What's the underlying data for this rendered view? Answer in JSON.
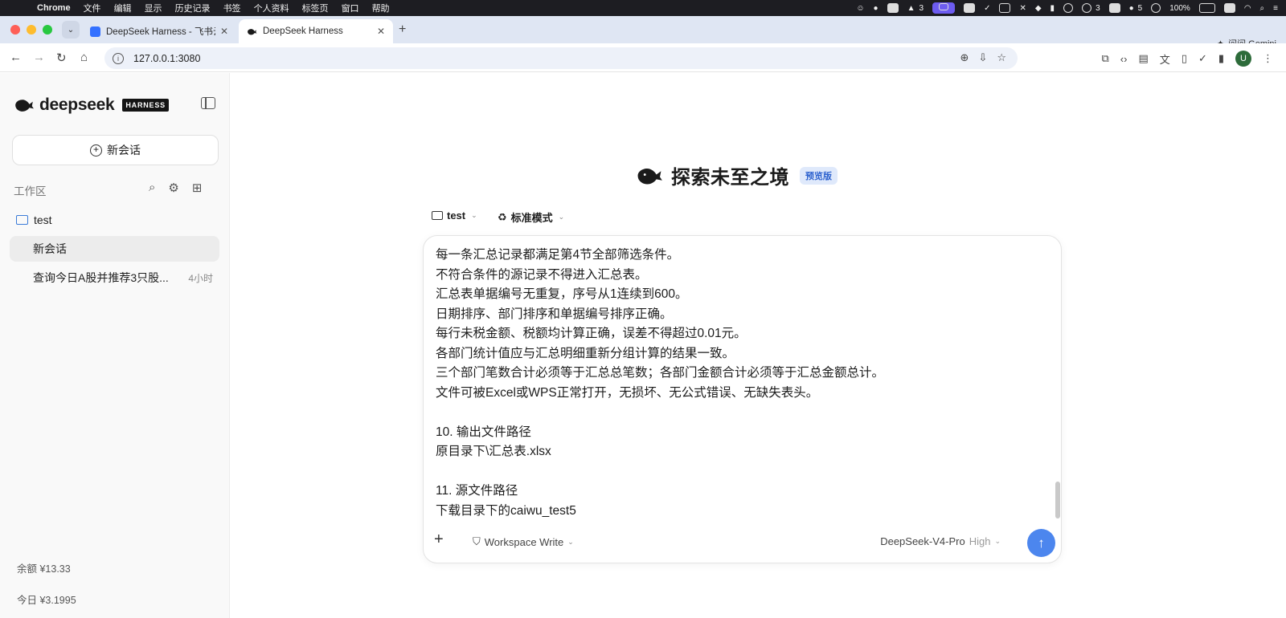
{
  "menubar": {
    "app": "Chrome",
    "items": [
      "文件",
      "编辑",
      "显示",
      "历史记录",
      "书签",
      "个人资料",
      "标签页",
      "窗口",
      "帮助"
    ],
    "status_count_a": "3",
    "status_count_b": "3",
    "status_count_c": "5",
    "battery": "100%"
  },
  "browser": {
    "tabs": [
      {
        "title": "DeepSeek Harness - 飞书云文档",
        "active": false
      },
      {
        "title": "DeepSeek Harness",
        "active": true
      }
    ],
    "url": "127.0.0.1:3080",
    "gemini_label": "问问 Gemini",
    "avatar_letter": "U"
  },
  "sidebar": {
    "brand": "deepseek",
    "badge": "HARNESS",
    "new_chat_label": "新会话",
    "workspace_label": "工作区",
    "folder_name": "test",
    "chats": [
      {
        "title": "新会话",
        "time": "",
        "selected": true
      },
      {
        "title": "查询今日A股并推荐3只股...",
        "time": "4小时",
        "selected": false
      }
    ],
    "balance": "余额 ¥13.33",
    "today": "今日 ¥3.1995"
  },
  "main": {
    "title": "探索未至之境",
    "badge": "预览版",
    "folder_selector": "test",
    "mode_selector": "标准模式",
    "composer_lines": [
      "每一条汇总记录都满足第4节全部筛选条件。",
      "不符合条件的源记录不得进入汇总表。",
      "汇总表单据编号无重复，序号从1连续到600。",
      "日期排序、部门排序和单据编号排序正确。",
      "每行未税金额、税额均计算正确，误差不得超过0.01元。",
      "各部门统计值应与汇总明细重新分组计算的结果一致。",
      "三个部门笔数合计必须等于汇总总笔数；各部门金额合计必须等于汇总金额总计。",
      "文件可被Excel或WPS正常打开，无损坏、无公式错误、无缺失表头。",
      "",
      "10. 输出文件路径",
      "原目录下\\汇总表.xlsx",
      "",
      "11. 源文件路径",
      "下载目录下的caiwu_test5"
    ],
    "permission": "Workspace Write",
    "model": "DeepSeek-V4-Pro",
    "level": "High"
  },
  "colors": {
    "accent": "#4c86ee",
    "badge_bg": "#dfe9fb",
    "badge_text": "#2e63cf",
    "sidebar_bg": "#f9f9f9",
    "tabstrip_bg": "#dfe6f3"
  }
}
